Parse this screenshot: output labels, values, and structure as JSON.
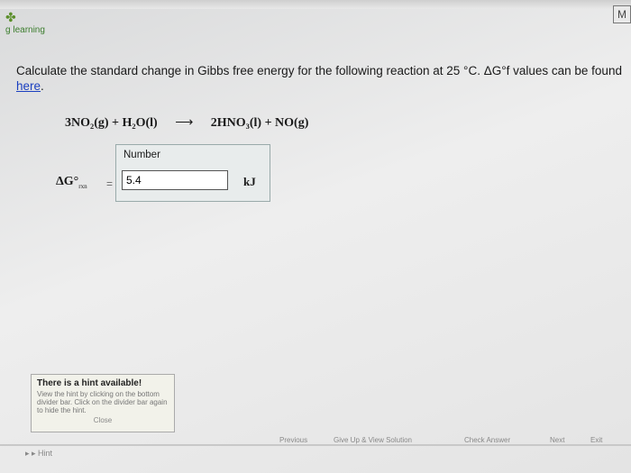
{
  "header": {
    "brand": "learning",
    "corner_label": "M"
  },
  "question": {
    "text": "Calculate the standard change in Gibbs free energy for the following reaction at 25 °C. ΔG°f values can be found ",
    "link_text": "here",
    "end": "."
  },
  "reaction": {
    "reactants": "3NO₂(g) + H₂O(l)",
    "arrow": "⟶",
    "products": "2HNO₃(l) + NO(g)"
  },
  "answer": {
    "label": "ΔG°",
    "subscript": "rxn",
    "equals": "=",
    "box_header": "Number",
    "value": "5.4",
    "unit": "kJ"
  },
  "hint": {
    "title": "There is a hint available!",
    "body": "View the hint by clicking on the bottom divider bar. Click on the divider bar again to hide the hint.",
    "close_label": "Close",
    "tab_label": "Hint"
  },
  "toolbar": {
    "previous": "Previous",
    "give_up": "Give Up & View Solution",
    "check": "Check Answer",
    "next": "Next",
    "exit": "Exit"
  }
}
